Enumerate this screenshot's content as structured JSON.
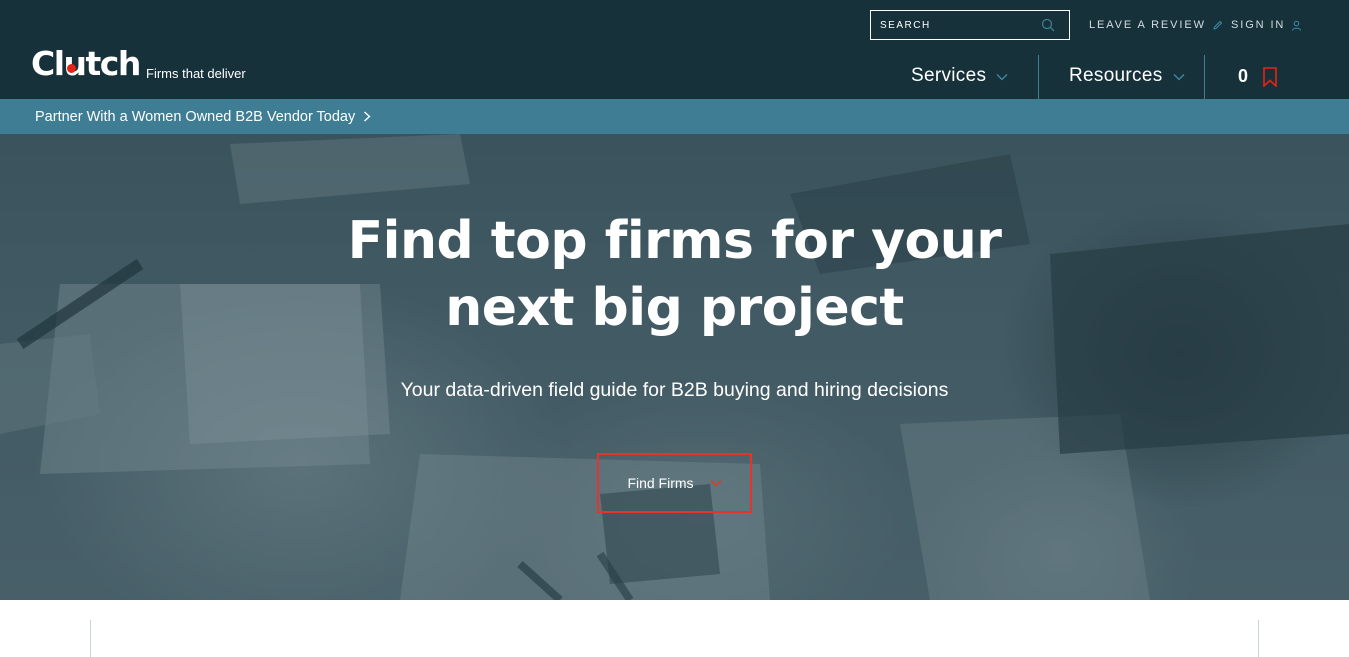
{
  "header": {
    "logo_text": "Clutch",
    "tagline": "Firms that deliver",
    "search": {
      "placeholder": "SEARCH"
    },
    "leave_review": "LEAVE A REVIEW",
    "sign_in": "SIGN IN",
    "nav": [
      {
        "label": "Services"
      },
      {
        "label": "Resources"
      }
    ],
    "saved_count": "0",
    "icons": [
      "search-icon",
      "pencil-icon",
      "user-icon",
      "chevron-down-icon",
      "bookmark-icon"
    ],
    "colors": {
      "header_bg": "#17313b",
      "accent": "#e62415",
      "banner_bg": "#3e7d94"
    }
  },
  "banner": {
    "text": "Partner With a Women Owned B2B Vendor Today"
  },
  "hero": {
    "title_line1": "Find top firms for your",
    "title_line2": "next big project",
    "subtitle": "Your data-driven field guide for B2B buying and hiring decisions",
    "cta_label": "Find Firms",
    "cta_border_color": "#e3352b"
  }
}
